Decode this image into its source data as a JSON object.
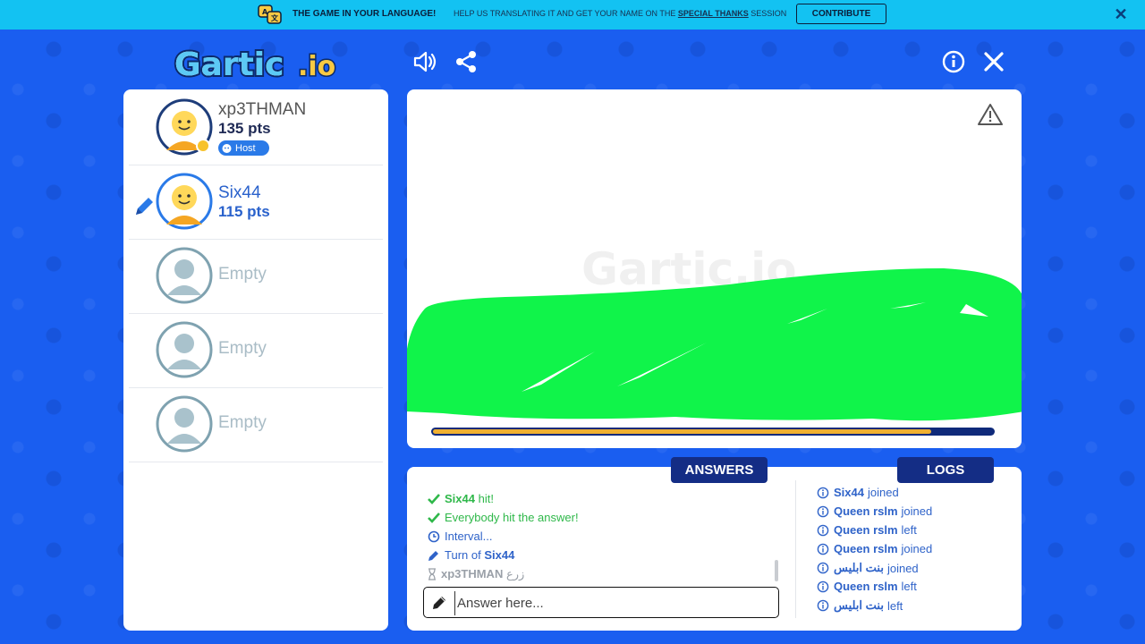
{
  "banner": {
    "headline": "THE GAME IN YOUR LANGUAGE!",
    "sub_prefix": "HELP US TRANSLATING IT AND GET YOUR NAME ON THE ",
    "sub_link": "SPECIAL THANKS",
    "sub_suffix": " SESSION",
    "contribute_label": "CONTRIBUTE",
    "close_label": "✕"
  },
  "header": {
    "logo_text": "Gartic.io",
    "icons": [
      "speaker-icon",
      "share-icon",
      "info-icon",
      "close-icon"
    ]
  },
  "players": [
    {
      "name": "xp3THMAN",
      "points": "135 pts",
      "badge": "Host",
      "state": "active"
    },
    {
      "name": "Six44",
      "points": "115 pts",
      "state": "drawing"
    },
    {
      "name": "Empty",
      "points": "",
      "state": "empty"
    },
    {
      "name": "Empty",
      "points": "",
      "state": "empty"
    },
    {
      "name": "Empty",
      "points": "",
      "state": "empty"
    }
  ],
  "canvas": {
    "watermark": "Gartic.io",
    "progress_fraction": 0.89
  },
  "tabs": {
    "answers_label": "ANSWERS",
    "logs_label": "LOGS"
  },
  "answers": [
    {
      "icon": "check-icon",
      "pre": "",
      "name": "Six44",
      "post": " hit!",
      "color": "#2fb84a"
    },
    {
      "icon": "check-icon",
      "pre": "Everybody hit the answer!",
      "name": "",
      "post": "",
      "color": "#2fb84a"
    },
    {
      "icon": "clock-icon",
      "pre": "Interval...",
      "name": "",
      "post": "",
      "color": "#2f63c9"
    },
    {
      "icon": "pencil-icon",
      "pre": "Turn of ",
      "name": "Six44",
      "post": "",
      "color": "#2f63c9"
    },
    {
      "icon": "hourglass-icon",
      "pre": "",
      "name": "xp3THMAN",
      "post": " زرع",
      "color": "#9aa0a8"
    }
  ],
  "logs": [
    {
      "name": "Six44",
      "action": "joined"
    },
    {
      "name": "Queen rslm",
      "action": "joined"
    },
    {
      "name": "Queen rslm",
      "action": "left"
    },
    {
      "name": "Queen rslm",
      "action": "joined"
    },
    {
      "name": "بنت ابليس",
      "action": "joined"
    },
    {
      "name": "Queen rslm",
      "action": "left"
    },
    {
      "name": "بنت ابليس",
      "action": "left"
    }
  ],
  "answer_input": {
    "placeholder": "Answer here..."
  },
  "colors": {
    "background": "#1a5ef0",
    "banner": "#13c2f2",
    "tab": "#142d85",
    "accent_green": "#2fb84a",
    "accent_blue": "#2f63c9",
    "drawing_green": "#10f44a",
    "progress": "#f0b030"
  }
}
